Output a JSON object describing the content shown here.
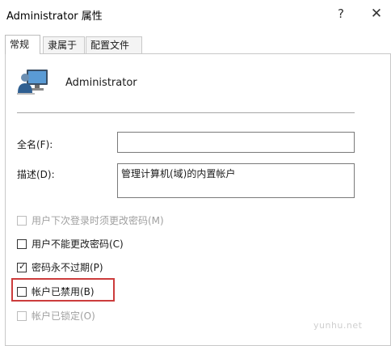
{
  "window": {
    "title": "Administrator 属性",
    "help_glyph": "?",
    "close_glyph": "✕"
  },
  "tabs": [
    {
      "label": "常规",
      "active": true
    },
    {
      "label": "隶属于",
      "active": false
    },
    {
      "label": "配置文件",
      "active": false
    }
  ],
  "user": {
    "name": "Administrator",
    "icon": "computer-user-icon"
  },
  "form": {
    "fullname_label": "全名(F):",
    "fullname_value": "",
    "description_label": "描述(D):",
    "description_value": "管理计算机(域)的内置帐户"
  },
  "options": [
    {
      "label": "用户下次登录时须更改密码(M)",
      "checked": false,
      "enabled": false
    },
    {
      "label": "用户不能更改密码(C)",
      "checked": false,
      "enabled": true
    },
    {
      "label": "密码永不过期(P)",
      "checked": true,
      "enabled": true
    },
    {
      "label": "帐户已禁用(B)",
      "checked": false,
      "enabled": true
    },
    {
      "label": "帐户已锁定(O)",
      "checked": false,
      "enabled": false
    }
  ],
  "watermark": "yunhu.net",
  "colors": {
    "highlight": "#cc3c3c",
    "border": "#c8c8c8",
    "disabled_text": "#a0a0a0"
  }
}
